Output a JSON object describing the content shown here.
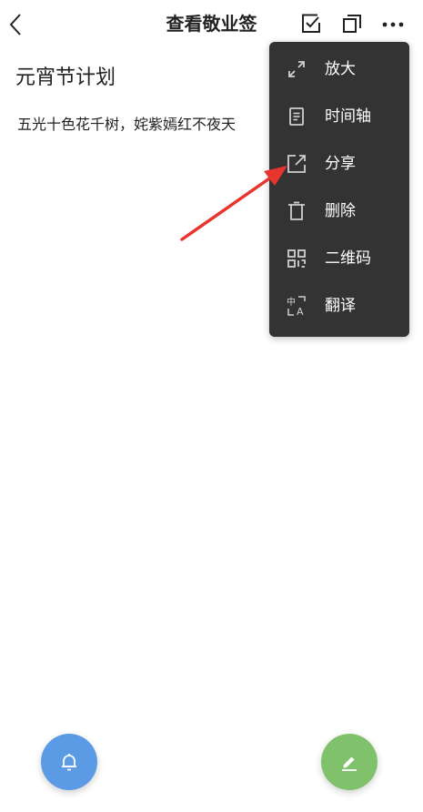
{
  "header": {
    "title": "查看敬业签",
    "back_icon": "chevron-left-icon",
    "action_icons": [
      "checkbox-icon",
      "copy-icon",
      "more-icon"
    ]
  },
  "note": {
    "title": "元宵节计划",
    "body": "五光十色花千树，姹紫嫣红不夜天"
  },
  "menu": {
    "items": [
      {
        "label": "放大",
        "icon": "expand-icon"
      },
      {
        "label": "时间轴",
        "icon": "timeline-icon"
      },
      {
        "label": "分享",
        "icon": "share-icon"
      },
      {
        "label": "删除",
        "icon": "trash-icon"
      },
      {
        "label": "二维码",
        "icon": "qr-code-icon"
      },
      {
        "label": "翻译",
        "icon": "translate-icon"
      }
    ],
    "background": "#333333"
  },
  "fabs": {
    "left": {
      "icon": "bell-icon",
      "color": "#5b9be6"
    },
    "right": {
      "icon": "pencil-icon",
      "color": "#7fc26b"
    }
  },
  "annotation": {
    "color": "#e8352f",
    "points_to": "分享"
  }
}
